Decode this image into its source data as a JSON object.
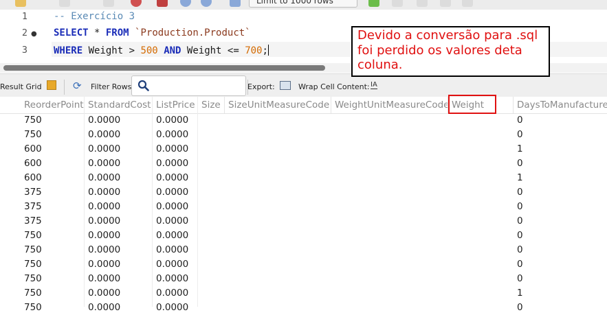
{
  "toolbar": {
    "limit_select": "Limit to 1000 rows",
    "icons": [
      "lightning-icon",
      "lightning-cursor-icon",
      "explain-icon",
      "stop-icon",
      "toggle-icon",
      "commit-icon",
      "beautify-icon",
      "search-icon",
      "invisible-chars-icon",
      "wrap-icon"
    ]
  },
  "editor": {
    "lines": [
      {
        "number": "1",
        "text": "-- Exercício 3"
      },
      {
        "number": "2",
        "text": "SELECT * FROM `Production.Product`"
      },
      {
        "number": "3",
        "text": "WHERE Weight > 500 AND Weight <= 700;"
      }
    ],
    "tokens": {
      "comment": "-- Exercício 3",
      "select": "SELECT",
      "star": " * ",
      "from": "FROM",
      "table": "`Production.Product`",
      "where": "WHERE",
      "weight1": " Weight > ",
      "v500": "500",
      "and": "AND",
      "weight2": " Weight <= ",
      "v700": "700",
      "semicolon": ";"
    },
    "annotation": "Devido a conversão para .sql foi perdido os valores deta coluna."
  },
  "result_toolbar": {
    "result_grid": "Result Grid",
    "filter_rows": "Filter Rows:",
    "export": "Export:",
    "wrap_cell": "Wrap Cell Content:"
  },
  "grid": {
    "columns": [
      "ReorderPoint",
      "StandardCost",
      "ListPrice",
      "Size",
      "SizeUnitMeasureCode",
      "WeightUnitMeasureCode",
      "Weight",
      "DaysToManufacture"
    ],
    "rows": [
      [
        "750",
        "0.0000",
        "0.0000",
        "",
        "",
        "",
        "",
        "0"
      ],
      [
        "750",
        "0.0000",
        "0.0000",
        "",
        "",
        "",
        "",
        "0"
      ],
      [
        "600",
        "0.0000",
        "0.0000",
        "",
        "",
        "",
        "",
        "1"
      ],
      [
        "600",
        "0.0000",
        "0.0000",
        "",
        "",
        "",
        "",
        "0"
      ],
      [
        "600",
        "0.0000",
        "0.0000",
        "",
        "",
        "",
        "",
        "1"
      ],
      [
        "375",
        "0.0000",
        "0.0000",
        "",
        "",
        "",
        "",
        "0"
      ],
      [
        "375",
        "0.0000",
        "0.0000",
        "",
        "",
        "",
        "",
        "0"
      ],
      [
        "375",
        "0.0000",
        "0.0000",
        "",
        "",
        "",
        "",
        "0"
      ],
      [
        "750",
        "0.0000",
        "0.0000",
        "",
        "",
        "",
        "",
        "0"
      ],
      [
        "750",
        "0.0000",
        "0.0000",
        "",
        "",
        "",
        "",
        "0"
      ],
      [
        "750",
        "0.0000",
        "0.0000",
        "",
        "",
        "",
        "",
        "0"
      ],
      [
        "750",
        "0.0000",
        "0.0000",
        "",
        "",
        "",
        "",
        "0"
      ],
      [
        "750",
        "0.0000",
        "0.0000",
        "",
        "",
        "",
        "",
        "1"
      ],
      [
        "750",
        "0.0000",
        "0.0000",
        "",
        "",
        "",
        "",
        "0"
      ]
    ]
  }
}
